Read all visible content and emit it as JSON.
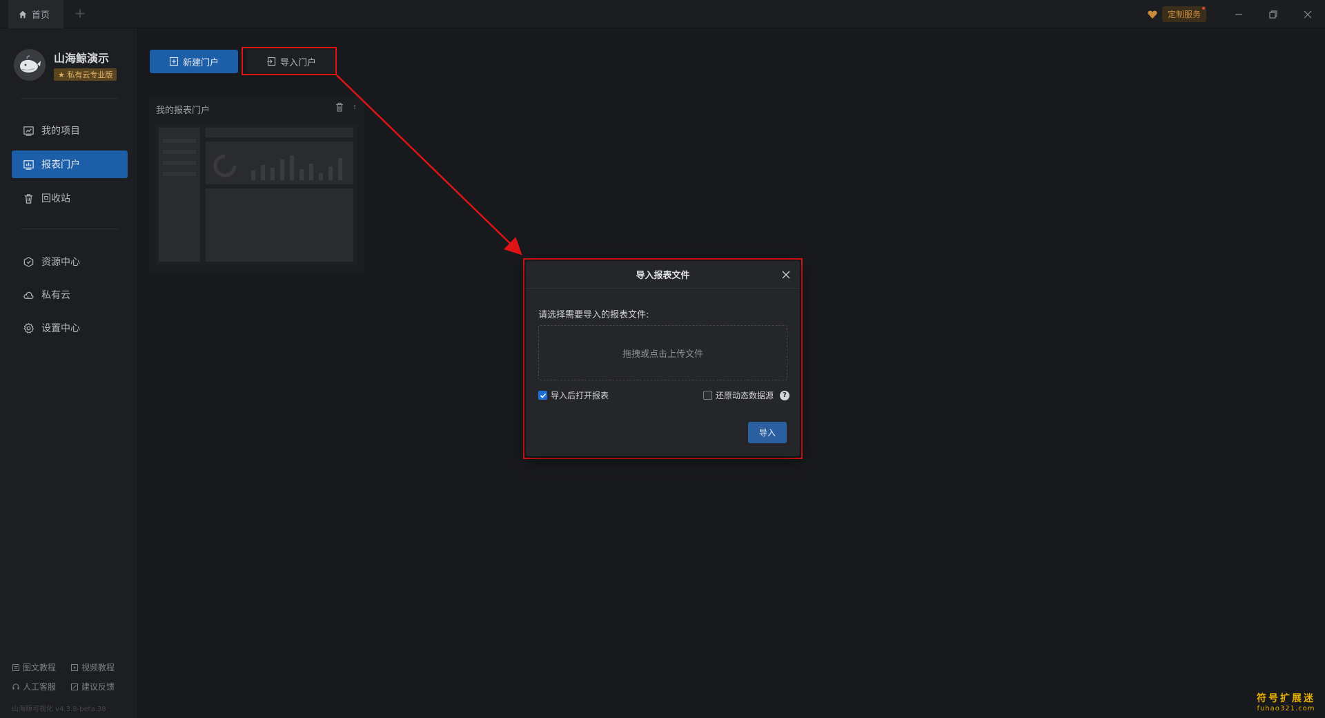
{
  "titlebar": {
    "home_tab": "首页",
    "add_tab": "+",
    "custom_service": "定制服务"
  },
  "sidebar": {
    "brand_name": "山海鲸演示",
    "brand_badge": "★ 私有云专业版",
    "nav_group1": [
      {
        "label": "我的项目",
        "icon": "project-icon"
      },
      {
        "label": "报表门户",
        "icon": "report-icon",
        "active": true
      },
      {
        "label": "回收站",
        "icon": "trash-icon"
      }
    ],
    "nav_group2": [
      {
        "label": "资源中心",
        "icon": "resource-icon"
      },
      {
        "label": "私有云",
        "icon": "cloud-icon"
      },
      {
        "label": "设置中心",
        "icon": "gear-icon"
      }
    ],
    "footer": {
      "tutorial_text": "图文教程",
      "tutorial_video": "视频教程",
      "support": "人工客服",
      "feedback": "建议反馈",
      "version": "山海鲸可视化 v4.3.8-beta.38"
    }
  },
  "main": {
    "new_portal": "新建门户",
    "import_portal": "导入门户",
    "portal_card_title": "我的报表门户"
  },
  "modal": {
    "title": "导入报表文件",
    "label": "请选择需要导入的报表文件:",
    "upload_hint": "拖拽或点击上传文件",
    "open_after_import": "导入后打开报表",
    "open_after_import_checked": true,
    "restore_dynamic": "还原动态数据源",
    "restore_dynamic_checked": false,
    "submit": "导入"
  },
  "watermark": {
    "cn": "符号扩展迷",
    "en": "fuhao321.com"
  },
  "colors": {
    "accent": "#1d5ea8",
    "highlight": "#e01414",
    "background": "#18191c"
  }
}
